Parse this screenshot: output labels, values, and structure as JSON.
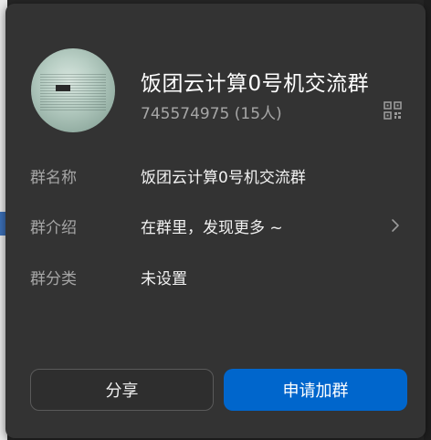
{
  "group": {
    "name": "饭团云计算0号机交流群",
    "id_and_members": "745574975 (15人)"
  },
  "info_rows": [
    {
      "label": "群名称",
      "value": "饭团云计算0号机交流群"
    },
    {
      "label": "群介绍",
      "value": "在群里，发现更多 ~"
    },
    {
      "label": "群分类",
      "value": "未设置"
    }
  ],
  "actions": {
    "share_label": "分享",
    "join_label": "申请加群"
  },
  "icons": {
    "qr": "qr-code-icon",
    "chevron": "chevron-right-icon"
  },
  "colors": {
    "primary": "#0066cc",
    "card_bg": "#333333",
    "label": "#a6a6a6"
  }
}
